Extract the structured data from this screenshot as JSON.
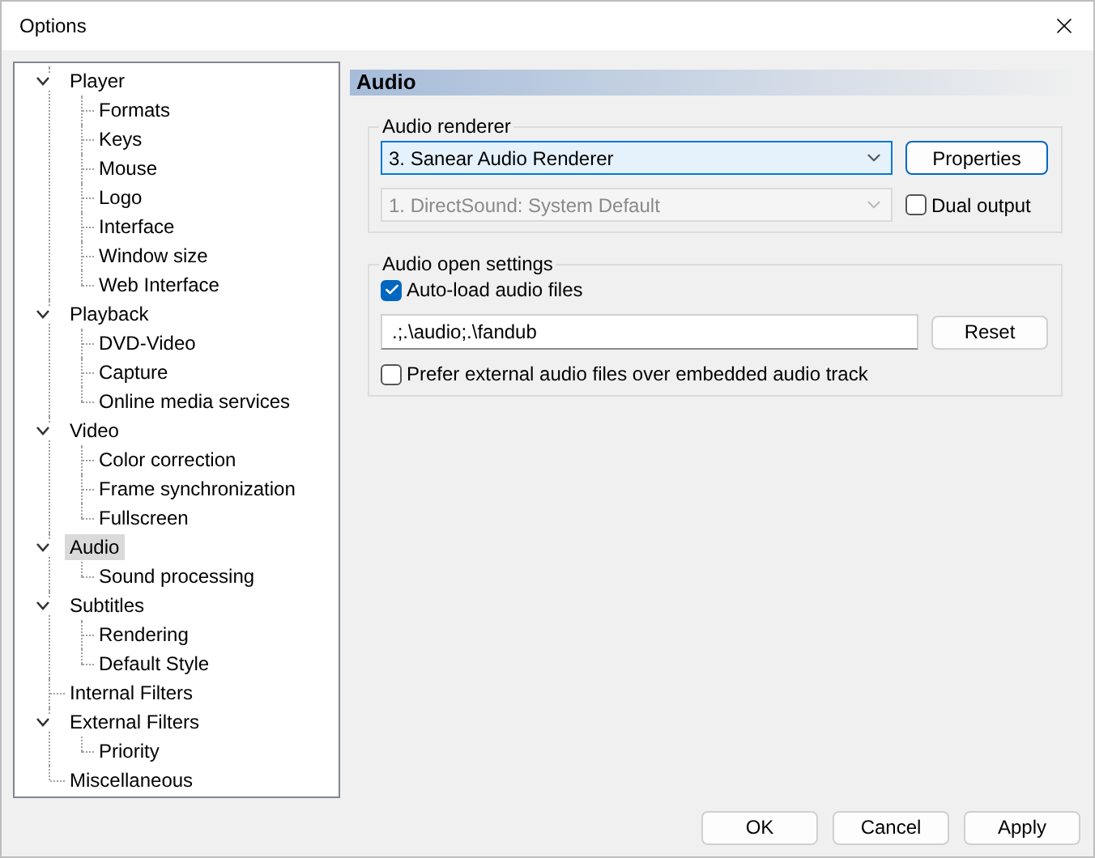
{
  "window": {
    "title": "Options"
  },
  "tree": [
    {
      "label": "Player",
      "expanded": true,
      "selected": false,
      "children": [
        {
          "label": "Formats",
          "selected": false
        },
        {
          "label": "Keys",
          "selected": false
        },
        {
          "label": "Mouse",
          "selected": false
        },
        {
          "label": "Logo",
          "selected": false
        },
        {
          "label": "Interface",
          "selected": false
        },
        {
          "label": "Window size",
          "selected": false
        },
        {
          "label": "Web Interface",
          "selected": false
        }
      ]
    },
    {
      "label": "Playback",
      "expanded": true,
      "selected": false,
      "children": [
        {
          "label": "DVD-Video",
          "selected": false
        },
        {
          "label": "Capture",
          "selected": false
        },
        {
          "label": "Online media services",
          "selected": false
        }
      ]
    },
    {
      "label": "Video",
      "expanded": true,
      "selected": false,
      "children": [
        {
          "label": "Color correction",
          "selected": false
        },
        {
          "label": "Frame synchronization",
          "selected": false
        },
        {
          "label": "Fullscreen",
          "selected": false
        }
      ]
    },
    {
      "label": "Audio",
      "expanded": true,
      "selected": true,
      "children": [
        {
          "label": "Sound processing",
          "selected": false
        }
      ]
    },
    {
      "label": "Subtitles",
      "expanded": true,
      "selected": false,
      "children": [
        {
          "label": "Rendering",
          "selected": false
        },
        {
          "label": "Default Style",
          "selected": false
        }
      ]
    },
    {
      "label": "Internal Filters",
      "selected": false
    },
    {
      "label": "External Filters",
      "expanded": true,
      "selected": false,
      "children": [
        {
          "label": "Priority",
          "selected": false
        }
      ]
    },
    {
      "label": "Miscellaneous",
      "selected": false
    }
  ],
  "page": {
    "title": "Audio",
    "renderer": {
      "legend": "Audio renderer",
      "device": {
        "value": "3. Sanear Audio Renderer",
        "disabled": false
      },
      "properties_button": "Properties",
      "secondary_device": {
        "value": "1. DirectSound: System Default",
        "disabled": true
      },
      "dual_output": {
        "label": "Dual output",
        "checked": false
      }
    },
    "open_settings": {
      "legend": "Audio open settings",
      "auto_load": {
        "label": "Auto-load audio files",
        "checked": true
      },
      "paths": ".;.\\audio;.\\fandub",
      "reset_button": "Reset",
      "prefer_external": {
        "label": "Prefer external audio files over embedded audio track",
        "checked": false
      }
    }
  },
  "buttons": [
    "OK",
    "Cancel",
    "Apply"
  ]
}
